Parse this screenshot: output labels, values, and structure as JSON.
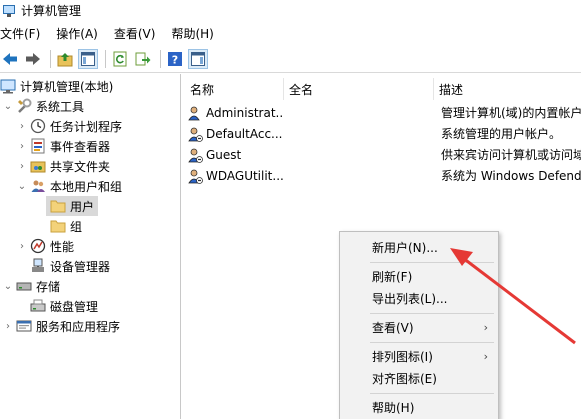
{
  "window": {
    "title": "计算机管理"
  },
  "menubar": [
    "文件(F)",
    "操作(A)",
    "查看(V)",
    "帮助(H)"
  ],
  "toolbar": {
    "buttons": [
      "back-icon",
      "forward-icon",
      "up-folder-icon",
      "show-hide-tree-icon",
      "refresh-icon",
      "export-list-icon",
      "help-icon",
      "show-hide-action-pane-icon"
    ]
  },
  "tree": {
    "root": "计算机管理(本地)",
    "system_tools": "系统工具",
    "task_scheduler": "任务计划程序",
    "event_viewer": "事件查看器",
    "shared_folders": "共享文件夹",
    "local_users_groups": "本地用户和组",
    "users": "用户",
    "groups": "组",
    "performance": "性能",
    "device_manager": "设备管理器",
    "storage": "存储",
    "disk_management": "磁盘管理",
    "services_apps": "服务和应用程序"
  },
  "list": {
    "columns": [
      "名称",
      "全名",
      "描述"
    ],
    "rows": [
      {
        "name": "Administrat...",
        "fullname": "",
        "desc": "管理计算机(域)的内置帐户"
      },
      {
        "name": "DefaultAcc...",
        "fullname": "",
        "desc": "系统管理的用户帐户。"
      },
      {
        "name": "Guest",
        "fullname": "",
        "desc": "供来宾访问计算机或访问域"
      },
      {
        "name": "WDAGUtilit...",
        "fullname": "",
        "desc": "系统为 Windows Defend"
      }
    ]
  },
  "context_menu": {
    "new_user": "新用户(N)...",
    "refresh": "刷新(F)",
    "export": "导出列表(L)...",
    "view": "查看(V)",
    "arrange": "排列图标(I)",
    "align": "对齐图标(E)",
    "help": "帮助(H)"
  },
  "annotation": {
    "color": "#e53935"
  }
}
